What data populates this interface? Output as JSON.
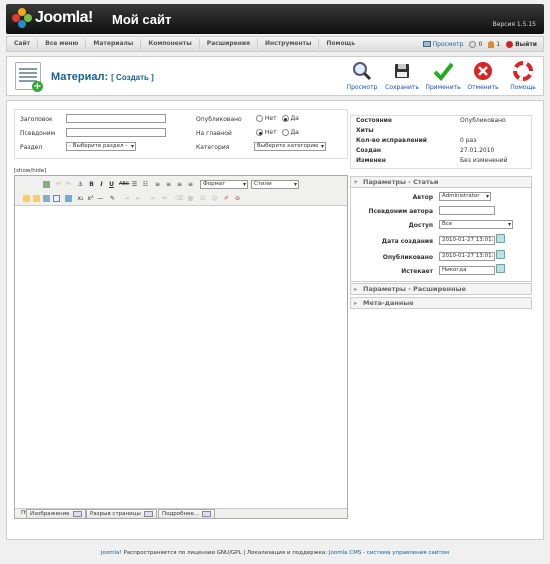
{
  "header": {
    "logo_text": "Joomla!",
    "site_title": "Мой сайт",
    "version": "Версия 1.5.15"
  },
  "menu": {
    "items": [
      "Сайт",
      "Все меню",
      "Материалы",
      "Компоненты",
      "Расширения",
      "Инструменты",
      "Помощь"
    ],
    "preview": "Просмотр",
    "messages_count": "0",
    "users_count": "1",
    "logout": "Выйти"
  },
  "toolbar": {
    "title": "Материал:",
    "subtitle": "[ Создать ]",
    "buttons": [
      "Просмотр",
      "Сохранить",
      "Применить",
      "Отменить",
      "Помощь"
    ]
  },
  "form": {
    "title_label": "Заголовок",
    "alias_label": "Псевдоним",
    "section_label": "Раздел",
    "section_value": "- Выберите раздел -",
    "published_label": "Опубликовано",
    "frontpage_label": "На главной",
    "category_label": "Категория",
    "category_value": "Выберите категорию",
    "no": "Нет",
    "yes": "Да"
  },
  "editor": {
    "showhide": "[show/hide]",
    "format": "Формат",
    "styles": "Стили",
    "path_label": "Путь:"
  },
  "extra_buttons": [
    "Изображение",
    "Разрыв страницы",
    "Подробнее..."
  ],
  "status": {
    "state_label": "Состояние",
    "state_value": "Опубликовано",
    "hits_label": "Хиты",
    "hits_value": "",
    "revisions_label": "Кол-во исправлений",
    "revisions_value": "0 раз",
    "created_label": "Создан",
    "created_value": "27.01.2010",
    "modified_label": "Изменен",
    "modified_value": "Без изменений"
  },
  "params": {
    "article_header": "Параметры - Статьи",
    "author_label": "Автор",
    "author_value": "Administrator",
    "alias_label": "Псевдоним автора",
    "alias_value": "",
    "access_label": "Доступ",
    "access_value": "Все",
    "created_label": "Дата создания",
    "created_value": "2010-01-27 13:01:30",
    "publish_label": "Опубликовано",
    "publish_value": "2010-01-27 13:01:30",
    "expires_label": "Истекает",
    "expires_value": "Никогда",
    "advanced_header": "Параметры - Расширенные",
    "meta_header": "Мета-данные"
  },
  "footer": {
    "joomla": "Joomla!",
    "text1": " Распространяется по лицензии GNU/GPL | Локализация и поддержка: ",
    "link2": "Joomla CMS - система управления сайтом"
  },
  "colors": {
    "accent": "#146295",
    "header_bg": "#1a1a1a"
  }
}
